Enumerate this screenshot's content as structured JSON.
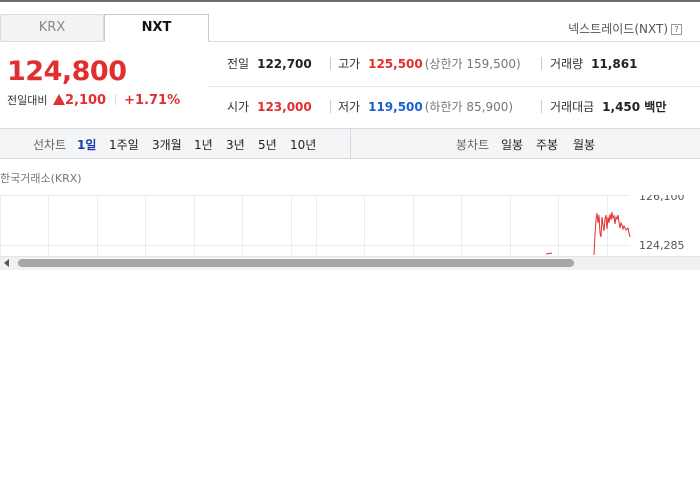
{
  "tabs": [
    {
      "label": "KRX"
    },
    {
      "label": "NXT"
    }
  ],
  "nxt_label": "넥스트레이드(NXT)",
  "help_glyph": "?",
  "price": {
    "current": "124,800",
    "change_label": "전일대비",
    "change_value": "2,100",
    "change_pct": "+1.71%"
  },
  "stats": {
    "prev_close": {
      "label": "전일",
      "value": "122,700"
    },
    "high": {
      "label": "고가",
      "value": "125,500",
      "sub": "(상한가 159,500)"
    },
    "volume": {
      "label": "거래량",
      "value": "11,861"
    },
    "open": {
      "label": "시가",
      "value": "123,000"
    },
    "low": {
      "label": "저가",
      "value": "119,500",
      "sub": "(하한가 85,900)"
    },
    "amount": {
      "label": "거래대금",
      "value": "1,450 백만"
    }
  },
  "controls": {
    "line_chart_label": "선차트",
    "periods": [
      "1일",
      "1주일",
      "3개월",
      "1년",
      "3년",
      "5년",
      "10년"
    ],
    "candle_chart_label": "봉차트",
    "candles": [
      "일봉",
      "주봉",
      "월봉"
    ]
  },
  "exchange_label": "한국거래소(KRX)",
  "chart": {
    "y_ticks": [
      "126,100",
      "124,285"
    ]
  },
  "colors": {
    "up": "#e12f2f",
    "down": "#1a5fd3",
    "active": "#1a3cad"
  }
}
